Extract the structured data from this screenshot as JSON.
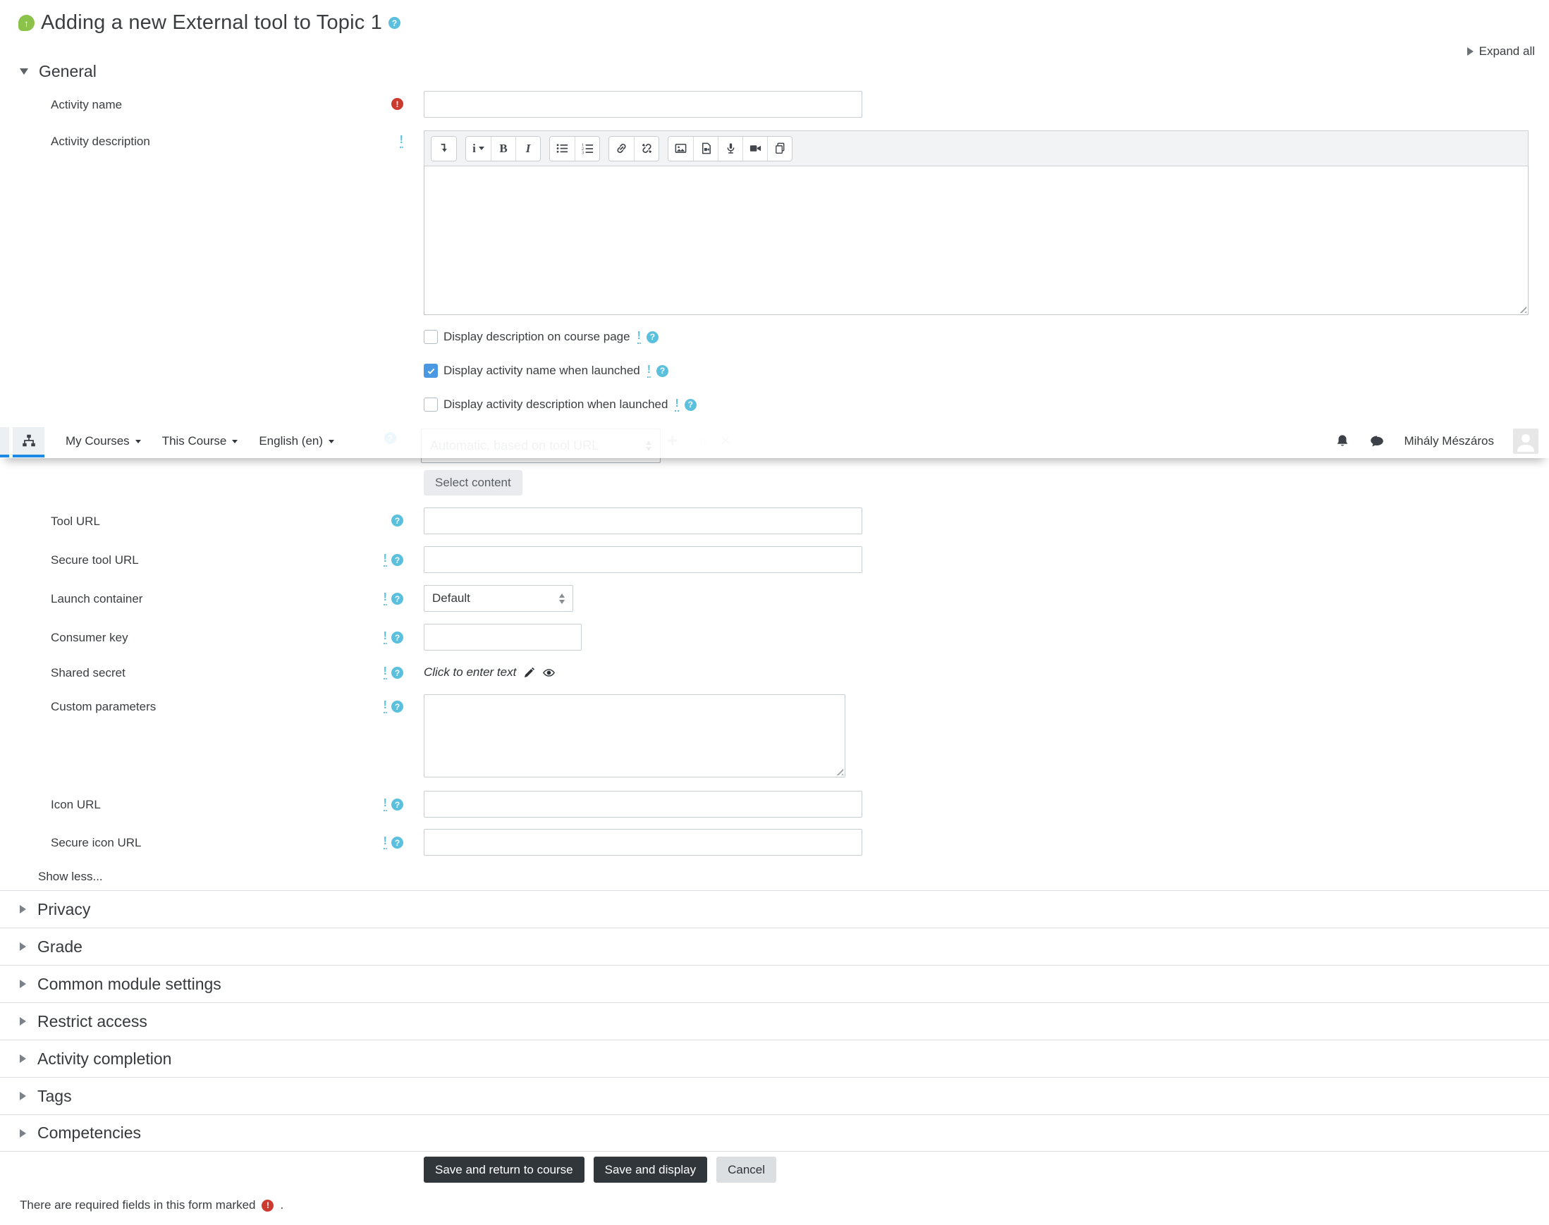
{
  "header": {
    "title": "Adding a new External tool to Topic 1",
    "expand_all": "Expand all"
  },
  "navbar": {
    "menus": [
      {
        "label": "My Courses"
      },
      {
        "label": "This Course"
      },
      {
        "label": "English (en)"
      }
    ],
    "user_name": "Mihály Mészáros"
  },
  "general": {
    "heading": "General",
    "activity_name": {
      "label": "Activity name",
      "value": ""
    },
    "activity_description": {
      "label": "Activity description",
      "value": ""
    },
    "checkboxes": [
      {
        "label": "Display description on course page",
        "checked": false
      },
      {
        "label": "Display activity name when launched",
        "checked": true
      },
      {
        "label": "Display activity description when launched",
        "checked": false
      }
    ],
    "preconfigured": {
      "select_value": "Automatic, based on tool URL"
    },
    "select_content_label": "Select content",
    "fields": {
      "tool_url": {
        "label": "Tool URL",
        "value": ""
      },
      "secure_tool_url": {
        "label": "Secure tool URL",
        "value": ""
      },
      "launch_container": {
        "label": "Launch container",
        "value": "Default"
      },
      "consumer_key": {
        "label": "Consumer key",
        "value": ""
      },
      "shared_secret": {
        "label": "Shared secret",
        "placeholder": "Click to enter text"
      },
      "custom_parameters": {
        "label": "Custom parameters",
        "value": ""
      },
      "icon_url": {
        "label": "Icon URL",
        "value": ""
      },
      "secure_icon_url": {
        "label": "Secure icon URL",
        "value": ""
      }
    },
    "show_less": "Show less..."
  },
  "editor": {
    "toolbar_icons": [
      "expand-toolbar",
      "format-style",
      "bold",
      "italic",
      "unordered-list",
      "ordered-list",
      "link",
      "unlink",
      "image",
      "media",
      "record-audio",
      "record-video",
      "manage-files"
    ]
  },
  "sections": [
    {
      "label": "Privacy"
    },
    {
      "label": "Grade"
    },
    {
      "label": "Common module settings"
    },
    {
      "label": "Restrict access"
    },
    {
      "label": "Activity completion"
    },
    {
      "label": "Tags"
    },
    {
      "label": "Competencies"
    }
  ],
  "actions": {
    "save_return": "Save and return to course",
    "save_display": "Save and display",
    "cancel": "Cancel"
  },
  "footer": {
    "required_note": "There are required fields in this form marked",
    "required_note_suffix": "."
  },
  "colors": {
    "accent_blue": "#1e88e5",
    "help_cyan": "#5bc0de",
    "required_red": "#ca3a2f",
    "button_dark": "#31363b",
    "tool_icon_green": "#8ac24a"
  }
}
